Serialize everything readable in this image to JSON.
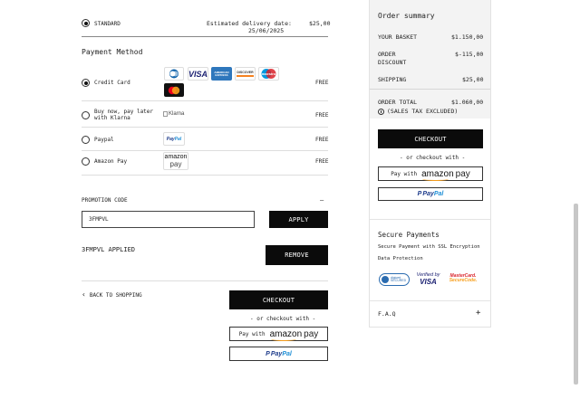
{
  "shipping": {
    "option_label": "STANDARD",
    "delivery_line1": "Estimated delivery date:",
    "delivery_line2": "25/06/2025",
    "price": "$25,00"
  },
  "payment": {
    "title": "Payment Method",
    "options": [
      {
        "label": "Credit Card",
        "price": "FREE",
        "selected": true
      },
      {
        "label_line1": "Buy now, pay later",
        "label_line2": "with Klarna",
        "logo_alt": "Klarna",
        "price": "FREE",
        "selected": false
      },
      {
        "label": "Paypal",
        "price": "FREE",
        "selected": false
      },
      {
        "label": "Amazon Pay",
        "price": "FREE",
        "selected": false
      }
    ],
    "card_logos": [
      "diners-icon",
      "visa-icon",
      "amex-icon",
      "discover-icon",
      "maestro-icon",
      "mastercard-icon"
    ],
    "card_logo_text": {
      "visa": "VISA",
      "amex": "AMERICAN EXPRESS",
      "discover": "DISCOVER",
      "maestro": "maestro"
    }
  },
  "promotion": {
    "title": "PROMOTION CODE",
    "toggle": "—",
    "input_value": "3FMPVL",
    "apply_label": "APPLY",
    "applied_text": "3FMPVL APPLIED",
    "remove_label": "REMOVE"
  },
  "footer_actions": {
    "back_label": "BACK TO SHOPPING",
    "checkout_label": "CHECKOUT",
    "or_checkout": "- or checkout with -",
    "amazon_pay_prefix": "Pay with",
    "amazon_word": "amazon",
    "amazon_pay_word": "pay",
    "paypal_p1": "Pay",
    "paypal_p2": "Pal"
  },
  "summary": {
    "title": "Order summary",
    "rows": [
      {
        "label": "YOUR BASKET",
        "value": "$1.150,00"
      },
      {
        "label_line1": "ORDER",
        "label_line2": "DISCOUNT",
        "value": "$-115,00"
      },
      {
        "label": "SHIPPING",
        "value": "$25,00"
      }
    ],
    "total_label": "ORDER TOTAL",
    "total_value": "$1.060,00",
    "tax_note": "(SALES TAX EXCLUDED)",
    "checkout_label": "CHECKOUT",
    "or_checkout": "- or checkout with -",
    "amazon_pay_prefix": "Pay with",
    "amazon_word": "amazon",
    "amazon_pay_word": "pay",
    "paypal_p1": "Pay",
    "paypal_p2": "Pal"
  },
  "secure": {
    "title": "Secure Payments",
    "line1": "Secure Payment with SSL Encryption",
    "line2": "Data Protection",
    "badges": {
      "digicert_line1": "digicert",
      "digicert_line2": "SECURED",
      "visa_line1": "Verified by",
      "visa_line2": "VISA",
      "mc_line1": "MasterCard.",
      "mc_line2": "SecureCode."
    }
  },
  "faq": {
    "label": "F.A.Q",
    "toggle": "+"
  }
}
